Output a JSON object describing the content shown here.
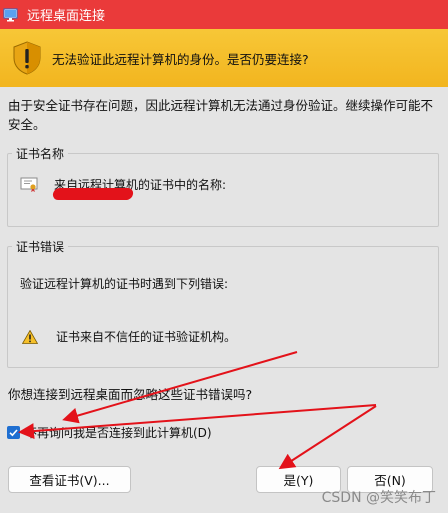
{
  "window": {
    "title": "远程桌面连接"
  },
  "banner": {
    "headline": "无法验证此远程计算机的身份。是否仍要连接?"
  },
  "description": "由于安全证书存在问题，因此远程计算机无法通过身份验证。继续操作可能不安全。",
  "cert_name_group": {
    "legend": "证书名称",
    "label": "来自远程计算机的证书中的名称:"
  },
  "cert_error_group": {
    "legend": "证书错误",
    "intro": "验证远程计算机的证书时遇到下列错误:",
    "error_item": "证书来自不信任的证书验证机构。"
  },
  "question": "你想连接到远程桌面而忽略这些证书错误吗?",
  "checkbox": {
    "label": "不再询问我是否连接到此计算机(D)",
    "checked": true
  },
  "buttons": {
    "view_cert": "查看证书(V)...",
    "yes": "是(Y)",
    "no": "否(N)"
  },
  "watermark": "CSDN @笑笑布丁",
  "colors": {
    "titlebar": "#ea3a3a",
    "banner": "#f2b51f",
    "checkbox_accent": "#1f6fd1",
    "annotation_red": "#e3121a"
  }
}
